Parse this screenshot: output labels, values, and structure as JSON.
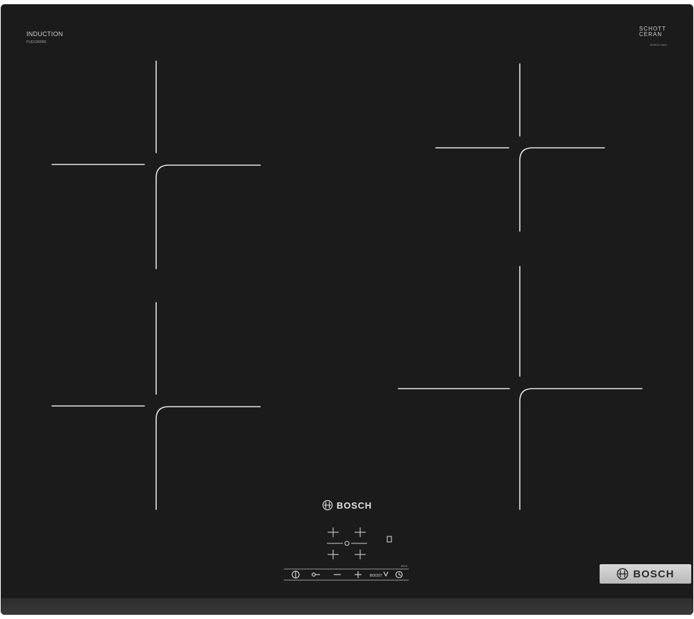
{
  "hob": {
    "type_label": "INDUCTION",
    "model_label": "PUE63KBB6",
    "glass_brand_line1": "SCHOTT",
    "glass_brand_line2": "CERAN",
    "glass_brand_sub": "BOSCH·NEU",
    "surface_color": "#1b1b1b",
    "marking_color": "#e8e8e8"
  },
  "center_brand": {
    "name": "BOSCH",
    "icon": "bosch-armature-icon"
  },
  "control_panel": {
    "mode_text": "BOOST",
    "small_text": "ECO",
    "buttons": [
      {
        "name": "power-button",
        "icon": "power-icon"
      },
      {
        "name": "child-lock-button",
        "icon": "key-icon"
      },
      {
        "name": "minus-button",
        "icon": "minus-icon"
      },
      {
        "name": "plus-button",
        "icon": "plus-icon"
      },
      {
        "name": "boost-button",
        "icon": "boost-icon"
      },
      {
        "name": "timer-button",
        "icon": "clock-icon"
      }
    ],
    "zone_selectors": [
      "front-left",
      "rear-left",
      "rear-right",
      "front-right"
    ]
  },
  "badge": {
    "brand": "BOSCH",
    "background": "#c9c9c9"
  }
}
